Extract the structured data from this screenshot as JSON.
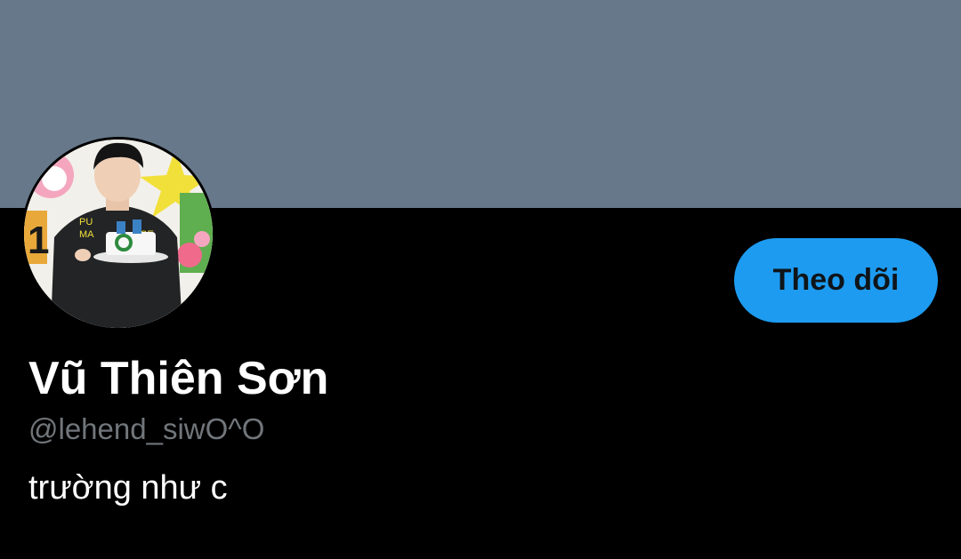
{
  "profile": {
    "display_name": "Vũ Thiên Sơn",
    "handle": "@lehend_siwO^O",
    "bio": "trường như c",
    "follow_button_label": "Theo dõi"
  },
  "colors": {
    "banner": "#66788a",
    "background": "#000000",
    "accent": "#1d9bf0",
    "handle_text": "#71767b",
    "primary_text": "#ffffff"
  },
  "icons": {
    "avatar": "profile-photo"
  }
}
